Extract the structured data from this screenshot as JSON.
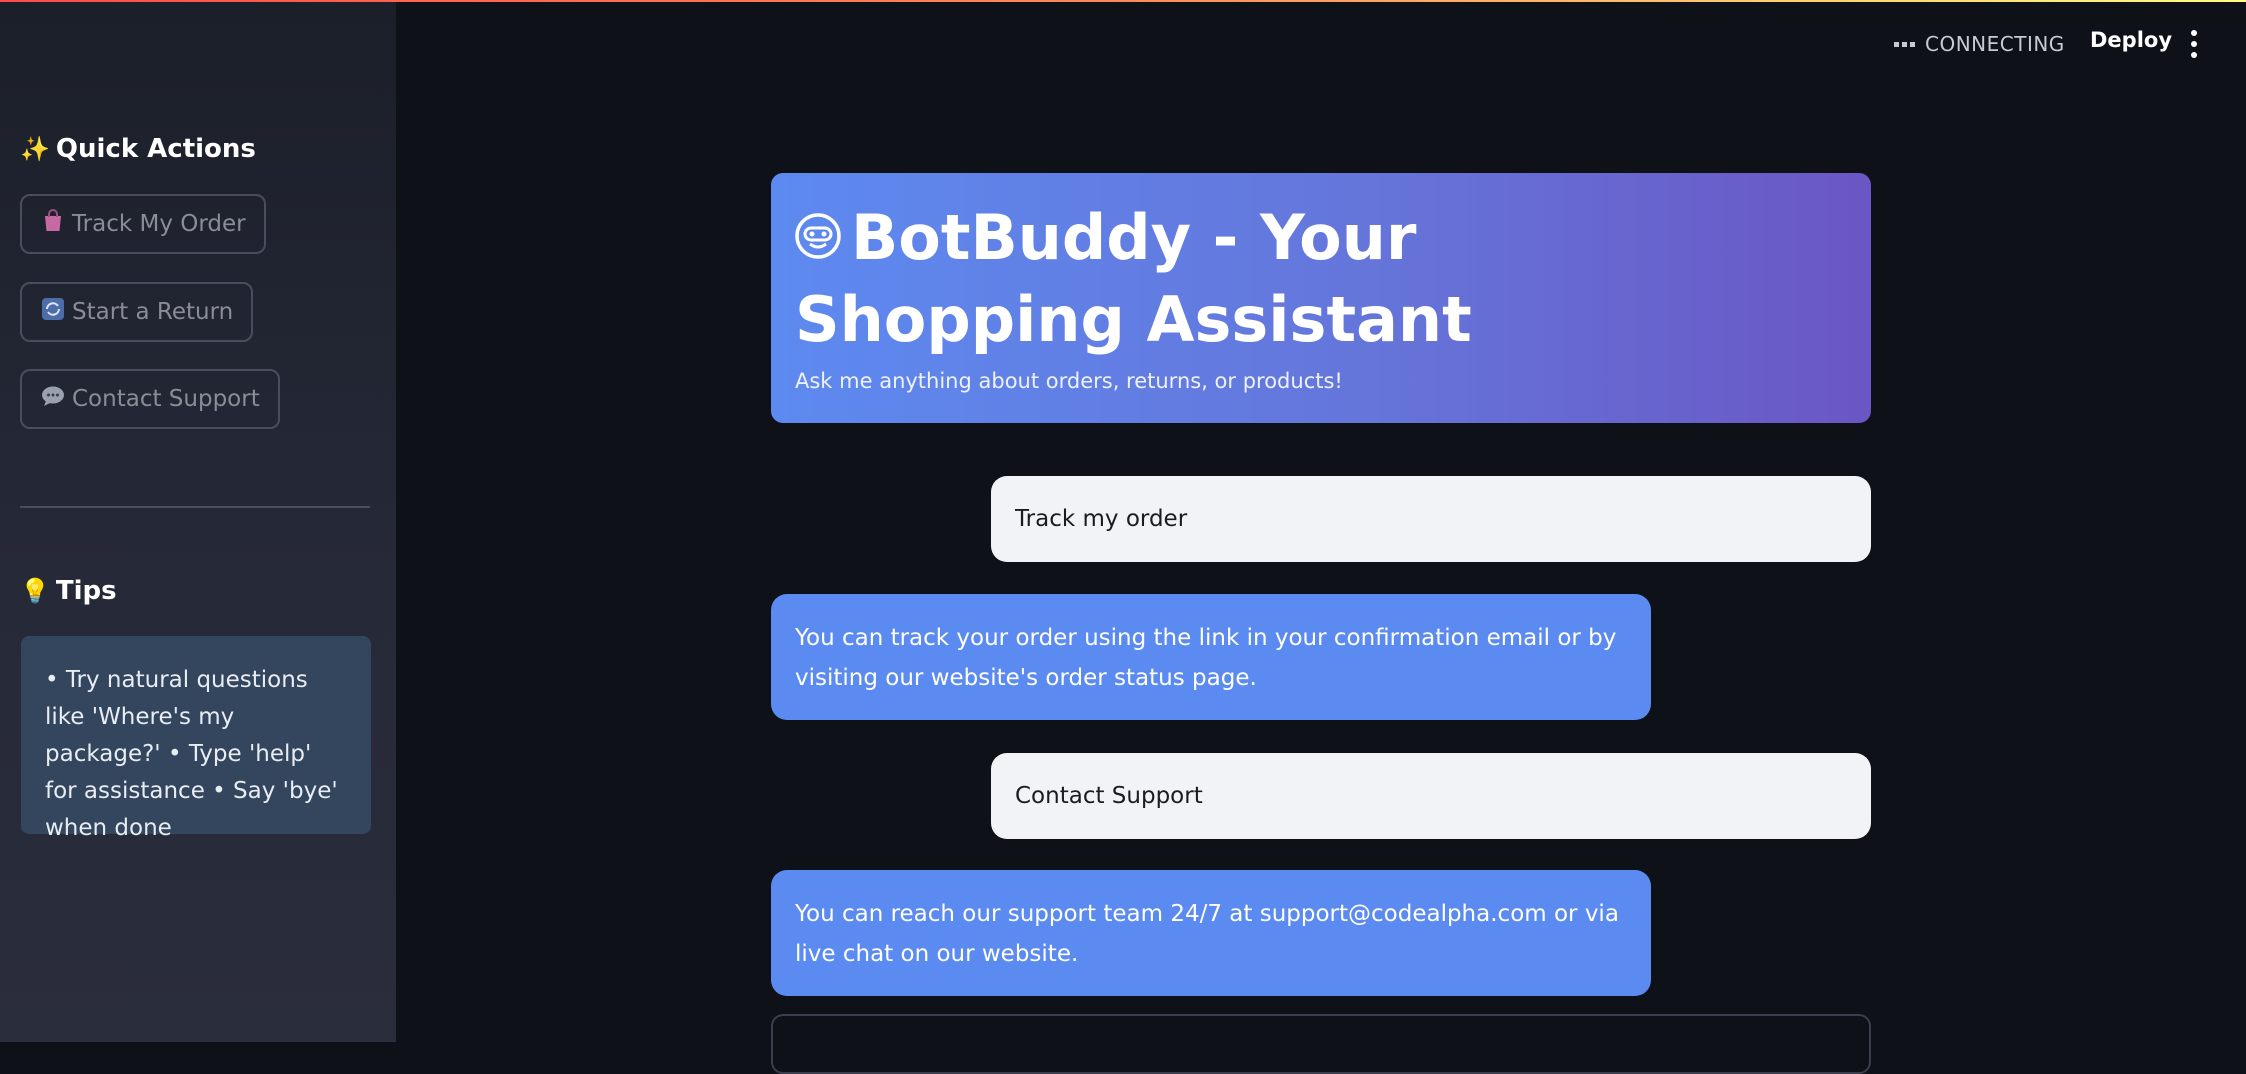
{
  "sidebar": {
    "quick_actions_heading": "Quick Actions",
    "quick_actions_icon": "sparkles-icon",
    "buttons": [
      {
        "label": "Track My Order",
        "icon": "shopping-bag-icon"
      },
      {
        "label": "Start a Return",
        "icon": "refresh-icon"
      },
      {
        "label": "Contact Support",
        "icon": "speech-bubble-icon"
      }
    ],
    "tips_heading": "Tips",
    "tips_icon": "lightbulb-icon",
    "tips_text": "• Try natural questions like 'Where's my package?' • Type 'help' for assistance • Say 'bye' when done"
  },
  "header": {
    "status": "CONNECTING",
    "deploy_label": "Deploy",
    "menu_icon": "kebab-menu-icon"
  },
  "banner": {
    "icon": "robot-face-icon",
    "title": "BotBuddy - Your Shopping Assistant",
    "subtitle": "Ask me anything about orders, returns, or products!"
  },
  "messages": [
    {
      "role": "user",
      "text": "Track my order"
    },
    {
      "role": "bot",
      "text": "You can track your order using the link in your confirmation email or by visiting our website's order status page."
    },
    {
      "role": "user",
      "text": "Contact Support"
    },
    {
      "role": "bot",
      "text": "You can reach our support team 24/7 at support@codealpha.com or via live chat on our website."
    }
  ],
  "colors": {
    "background": "#0e1117",
    "banner_start": "#5d8af0",
    "banner_end": "#6a56c4",
    "bot_bubble": "#5b8bf1",
    "user_bubble": "#f2f3f6",
    "tips_box": "#34455e"
  }
}
